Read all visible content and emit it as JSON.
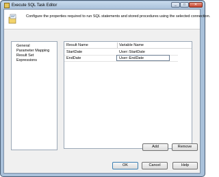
{
  "window": {
    "title": "Execute SQL Task Editor"
  },
  "banner": {
    "description": "Configure the properties required to run SQL statements and stored procedures using the selected connection."
  },
  "nav": {
    "items": [
      {
        "label": "General"
      },
      {
        "label": "Parameter Mapping"
      },
      {
        "label": "Result Set"
      },
      {
        "label": "Expressions"
      }
    ]
  },
  "grid": {
    "columns": [
      "Result Name",
      "Variable Name"
    ],
    "rows": [
      [
        "StartDate",
        "User::StartDate"
      ],
      [
        "EndDate",
        "User::EndDate"
      ]
    ]
  },
  "buttons": {
    "add": "Add",
    "remove": "Remove",
    "ok": "OK",
    "cancel": "Cancel",
    "help": "Help"
  },
  "icons": {
    "app": "task-editor-icon",
    "banner": "sql-task-icon",
    "minimize": "minimize-icon",
    "maximize": "maximize-icon",
    "close": "close-icon"
  }
}
